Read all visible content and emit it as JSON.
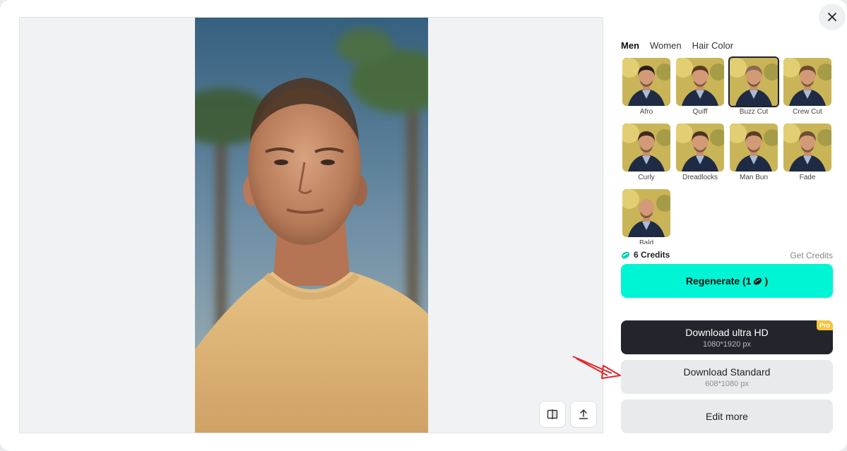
{
  "tabs": [
    {
      "label": "Men",
      "active": true
    },
    {
      "label": "Women",
      "active": false
    },
    {
      "label": "Hair Color",
      "active": false
    }
  ],
  "styles": [
    {
      "label": "Afro",
      "selected": false
    },
    {
      "label": "Quiff",
      "selected": false
    },
    {
      "label": "Buzz Cut",
      "selected": true
    },
    {
      "label": "Crew Cut",
      "selected": false
    },
    {
      "label": "Curly",
      "selected": false
    },
    {
      "label": "Dreadlocks",
      "selected": false
    },
    {
      "label": "Man Bun",
      "selected": false
    },
    {
      "label": "Fade",
      "selected": false
    },
    {
      "label": "Bald",
      "selected": false
    }
  ],
  "credits": {
    "label": "6 Credits",
    "get_label": "Get Credits"
  },
  "regenerate": {
    "label": "Regenerate (1",
    "suffix": ")"
  },
  "download_hd": {
    "label": "Download ultra HD",
    "size": "1080*1920 px",
    "badge": "Pro"
  },
  "download_standard": {
    "label": "Download Standard",
    "size": "608*1080 px"
  },
  "edit_more": {
    "label": "Edit more"
  },
  "colors": {
    "accent": "#00f5d4",
    "dark": "#22252b",
    "pro": "#f6c43a",
    "arrow": "#e0262b"
  }
}
